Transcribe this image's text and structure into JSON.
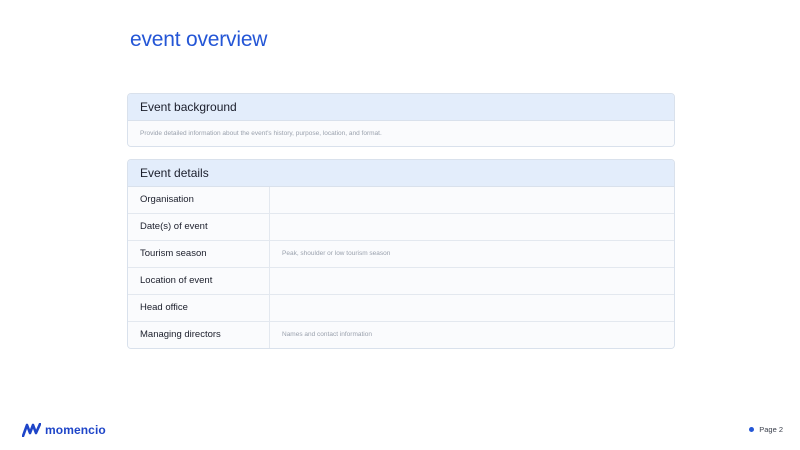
{
  "page": {
    "title": "event overview",
    "page_label": "Page 2"
  },
  "brand": {
    "name": "momencio",
    "accent": "#2456d6"
  },
  "background_section": {
    "header": "Event background",
    "text": "Provide detailed information about the event's history, purpose, location, and format."
  },
  "details_section": {
    "header": "Event details",
    "rows": [
      {
        "label": "Organisation",
        "value": ""
      },
      {
        "label": "Date(s) of event",
        "value": ""
      },
      {
        "label": "Tourism season",
        "value": "Peak, shoulder or low tourism season"
      },
      {
        "label": "Location of event",
        "value": ""
      },
      {
        "label": "Head office",
        "value": ""
      },
      {
        "label": "Managing directors",
        "value": "Names and contact information"
      }
    ]
  }
}
